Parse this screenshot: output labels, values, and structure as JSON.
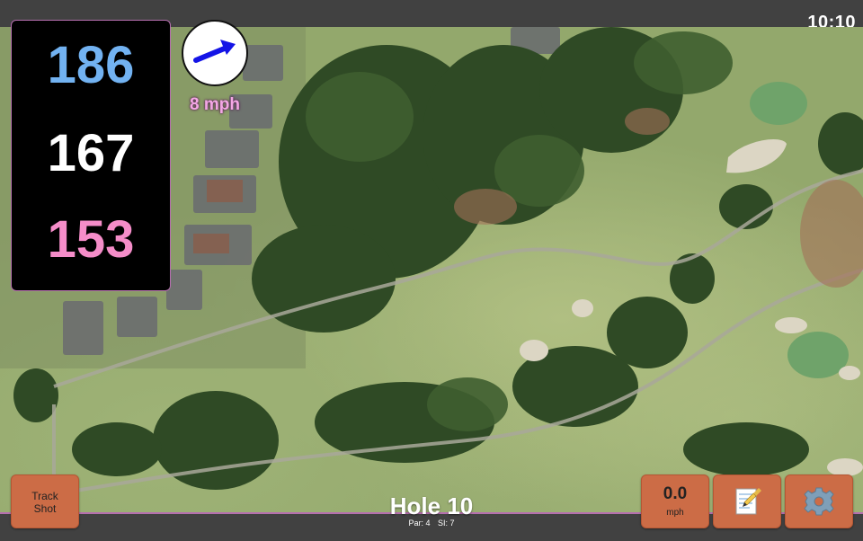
{
  "status_bar": {
    "time": "10:10"
  },
  "distances": {
    "back": "186",
    "middle": "167",
    "front": "153"
  },
  "wind": {
    "speed_label": "8 mph",
    "arrow_icon": "wind-direction-arrow-icon",
    "arrow_color": "#1414e6"
  },
  "buttons": {
    "track_shot_line1": "Track",
    "track_shot_line2": "Shot",
    "speed_value": "0.0",
    "speed_unit": "mph",
    "notes_icon": "notepad-icon",
    "settings_icon": "gear-icon"
  },
  "hole": {
    "title": "Hole 10",
    "par": "Par: 4",
    "stroke_index": "SI: 7"
  },
  "colors": {
    "accent_border": "#b56fae",
    "button_bg": "#cc6c46",
    "back_distance": "#72b2f1",
    "middle_distance": "#ffffff",
    "front_distance": "#f58dc9"
  }
}
